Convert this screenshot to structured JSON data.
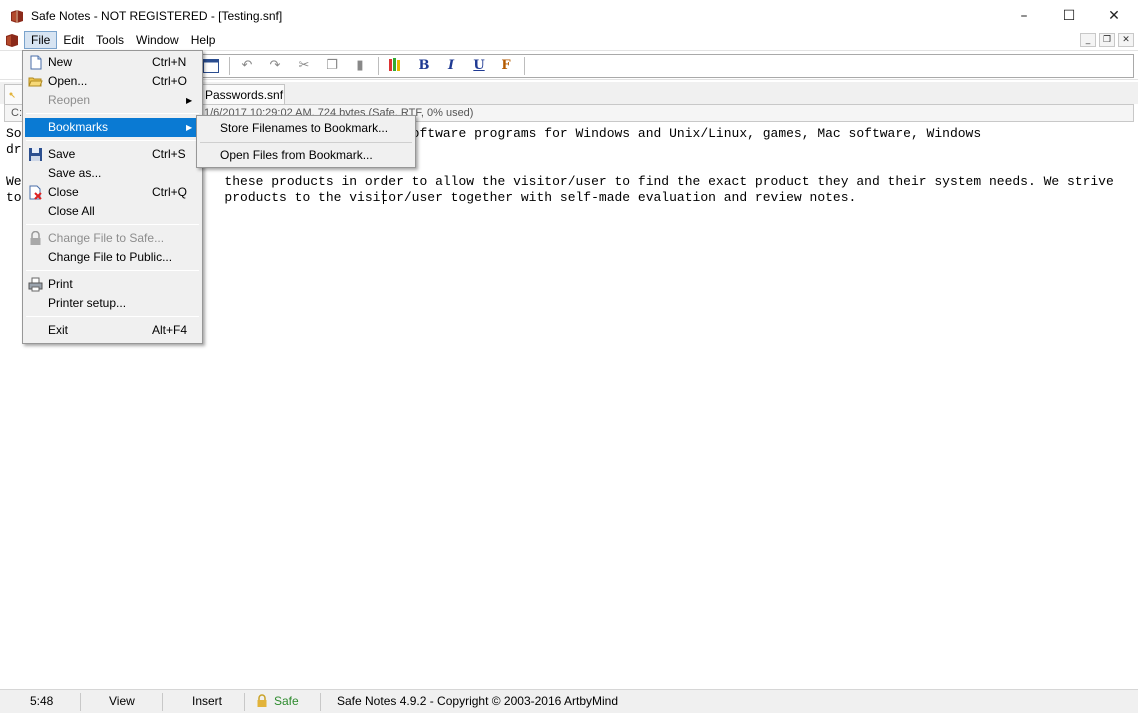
{
  "window": {
    "title": "Safe Notes - NOT REGISTERED - [Testing.snf]",
    "minimize": "–",
    "maximize": "☐",
    "close": "✕"
  },
  "menubar": {
    "items": [
      "File",
      "Edit",
      "Tools",
      "Window",
      "Help"
    ],
    "mdi_minimize": "_",
    "mdi_restore": "❐",
    "mdi_close": "✕"
  },
  "toolbar": {
    "undo": "↶",
    "redo": "↷",
    "cut": "✂",
    "copy": "❐",
    "paste": "▮",
    "bold": "B",
    "italic": "I",
    "underline": "U",
    "font": "F"
  },
  "tabs": {
    "first_label": "",
    "second_label": "Passwords.snf"
  },
  "infobar": {
    "path": "C:",
    "info": "1/6/2017 10:29:02 AM, 724 bytes (Safe, RTF, 0% used)"
  },
  "editor": {
    "line1": "So                                      ree-to-try software programs for Windows and Unix/Linux, games, Mac software, Windows",
    "line2": "dr",
    "line3": "We                          these products in order to allow the visitor/user to find the exact product they and their system needs. We strive",
    "line4": "to                          products to the visitor/user together with self-made evaluation and review notes."
  },
  "file_menu": {
    "new": {
      "label": "New",
      "shortcut": "Ctrl+N"
    },
    "open": {
      "label": "Open...",
      "shortcut": "Ctrl+O"
    },
    "reopen": {
      "label": "Reopen"
    },
    "bookmarks": {
      "label": "Bookmarks"
    },
    "save": {
      "label": "Save",
      "shortcut": "Ctrl+S"
    },
    "save_as": {
      "label": "Save as..."
    },
    "close": {
      "label": "Close",
      "shortcut": "Ctrl+Q"
    },
    "close_all": {
      "label": "Close All"
    },
    "change_safe": {
      "label": "Change File to Safe..."
    },
    "change_public": {
      "label": "Change File to Public..."
    },
    "print": {
      "label": "Print"
    },
    "printer_setup": {
      "label": "Printer setup..."
    },
    "exit": {
      "label": "Exit",
      "shortcut": "Alt+F4"
    }
  },
  "bookmarks_submenu": {
    "store": "Store Filenames to Bookmark...",
    "open": "Open Files from Bookmark..."
  },
  "statusbar": {
    "position": "5:48",
    "view": "View",
    "insert": "Insert",
    "safe": "Safe",
    "copyright": "Safe Notes 4.9.2  -  Copyright © 2003-2016 ArtbyMind"
  },
  "colors": {
    "highlight": "#0a7ad3",
    "safe_text": "#2e8b2e",
    "format_blue": "#1f3a93"
  }
}
